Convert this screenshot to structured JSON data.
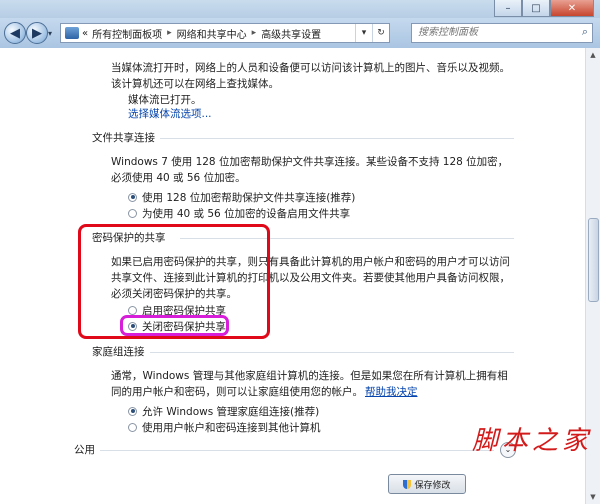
{
  "window": {
    "minimize_glyph": "–",
    "maximize_glyph": "□",
    "close_glyph": "✕"
  },
  "nav": {
    "back_glyph": "◀",
    "forward_glyph": "▶",
    "history_glyph": "▾",
    "prefix": "«",
    "breadcrumb": [
      "所有控制面板项",
      "网络和共享中心",
      "高级共享设置"
    ],
    "separator": "▸",
    "dropdown_glyph": "▾",
    "refresh_glyph": "↻",
    "search_placeholder": "搜索控制面板",
    "search_glyph": "⌕"
  },
  "media_section": {
    "description": "当媒体流打开时，网络上的人员和设备便可以访问该计算机上的图片、音乐以及视频。该计算机还可以在网络上查找媒体。",
    "status": "媒体流已打开。",
    "link": "选择媒体流选项..."
  },
  "file_sharing_section": {
    "title": "文件共享连接",
    "description": "Windows 7 使用 128 位加密帮助保护文件共享连接。某些设备不支持 128 位加密，必须使用 40 或 56 位加密。",
    "options": [
      {
        "label": "使用 128 位加密帮助保护文件共享连接(推荐)",
        "checked": true
      },
      {
        "label": "为使用 40 或 56 位加密的设备启用文件共享",
        "checked": false
      }
    ]
  },
  "password_section": {
    "title": "密码保护的共享",
    "description": "如果已启用密码保护的共享，则只有具备此计算机的用户帐户和密码的用户才可以访问共享文件、连接到此计算机的打印机以及公用文件夹。若要使其他用户具备访问权限，必须关闭密码保护的共享。",
    "options": [
      {
        "label": "启用密码保护共享",
        "checked": false
      },
      {
        "label": "关闭密码保护共享",
        "checked": true
      }
    ]
  },
  "homegroup_section": {
    "title": "家庭组连接",
    "description": "通常，Windows 管理与其他家庭组计算机的连接。但是如果您在所有计算机上拥有相同的用户帐户和密码，则可以让家庭组使用您的帐户。",
    "help_link": "帮助我决定",
    "options": [
      {
        "label": "允许 Windows 管理家庭组连接(推荐)",
        "checked": true
      },
      {
        "label": "使用用户帐户和密码连接到其他计算机",
        "checked": false
      }
    ]
  },
  "public_section": {
    "title": "公用",
    "expand_glyph": "⌄"
  },
  "footer": {
    "save_label": "保存修改"
  },
  "scrollbar": {
    "up_glyph": "▲",
    "down_glyph": "▼"
  },
  "watermark": {
    "text": "脚本之家"
  },
  "colors": {
    "annotation_red": "#e0091a",
    "annotation_pink": "#d71ed8",
    "link": "#0645ad"
  }
}
